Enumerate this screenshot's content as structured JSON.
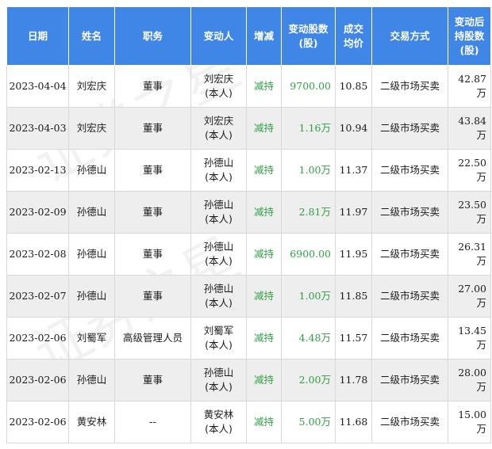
{
  "headers": [
    "日期",
    "姓名",
    "职务",
    "变动人",
    "增减",
    "变动股数\n(股)",
    "成交\n均价",
    "交易方式",
    "变动后\n持股数\n(股)"
  ],
  "rows": [
    {
      "date": "2023-04-04",
      "name": "刘宏庆",
      "title": "董事",
      "changer": "刘宏庆\n(本人)",
      "direction": "减持",
      "shares": "9700.00",
      "price": "10.85",
      "method": "二级市场买卖",
      "after": "42.87万"
    },
    {
      "date": "2023-04-03",
      "name": "刘宏庆",
      "title": "董事",
      "changer": "刘宏庆\n(本人)",
      "direction": "减持",
      "shares": "1.16万",
      "price": "10.94",
      "method": "二级市场买卖",
      "after": "43.84万"
    },
    {
      "date": "2023-02-13",
      "name": "孙德山",
      "title": "董事",
      "changer": "孙德山\n(本人)",
      "direction": "减持",
      "shares": "1.00万",
      "price": "11.37",
      "method": "二级市场买卖",
      "after": "22.50万"
    },
    {
      "date": "2023-02-09",
      "name": "孙德山",
      "title": "董事",
      "changer": "孙德山\n(本人)",
      "direction": "减持",
      "shares": "2.81万",
      "price": "11.97",
      "method": "二级市场买卖",
      "after": "23.50万"
    },
    {
      "date": "2023-02-08",
      "name": "孙德山",
      "title": "董事",
      "changer": "孙德山\n(本人)",
      "direction": "减持",
      "shares": "6900.00",
      "price": "11.95",
      "method": "二级市场买卖",
      "after": "26.31万"
    },
    {
      "date": "2023-02-07",
      "name": "孙德山",
      "title": "董事",
      "changer": "孙德山\n(本人)",
      "direction": "减持",
      "shares": "1.00万",
      "price": "11.85",
      "method": "二级市场买卖",
      "after": "27.00万"
    },
    {
      "date": "2023-02-06",
      "name": "刘蜀军",
      "title": "高级管理人员",
      "changer": "刘蜀军\n(本人)",
      "direction": "减持",
      "shares": "4.48万",
      "price": "11.57",
      "method": "二级市场买卖",
      "after": "13.45万"
    },
    {
      "date": "2023-02-06",
      "name": "孙德山",
      "title": "董事",
      "changer": "孙德山\n(本人)",
      "direction": "减持",
      "shares": "2.00万",
      "price": "11.78",
      "method": "二级市场买卖",
      "after": "28.00万"
    },
    {
      "date": "2023-02-06",
      "name": "黄安林",
      "title": "--",
      "changer": "黄安林\n(本人)",
      "direction": "减持",
      "shares": "5.00万",
      "price": "11.68",
      "method": "二级市场买卖",
      "after": "15.00万"
    }
  ],
  "colors": {
    "header_bg": "#3f86e6",
    "header_text": "#ffffff",
    "decrease": "#2ea043",
    "alt_row": "#eeeeee"
  }
}
